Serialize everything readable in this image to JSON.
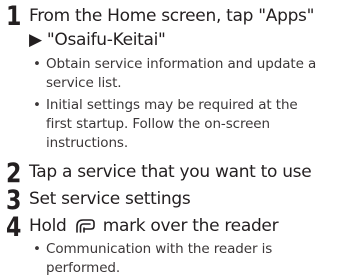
{
  "steps": [
    {
      "number": "1",
      "line1": "From the Home screen, tap \"Apps\"",
      "line2": "▶ \"Osaifu-Keitai\"",
      "notes": [
        {
          "bullet": "•",
          "line1": "Obtain service information and update a",
          "line2": "service list."
        },
        {
          "bullet": "•",
          "line1": "Initial settings may be required at the",
          "line2": "first startup. Follow the on-screen",
          "line3": "instructions."
        }
      ]
    },
    {
      "number": "2",
      "text": "Tap a service that you want to use"
    },
    {
      "number": "3",
      "text": "Set service settings"
    },
    {
      "number": "4",
      "text_before_icon": "Hold",
      "icon": "felica-mark-icon",
      "text_after_icon": "mark over the reader",
      "notes": [
        {
          "bullet": "•",
          "line1": "Communication with the reader is",
          "line2": "performed."
        }
      ]
    }
  ]
}
